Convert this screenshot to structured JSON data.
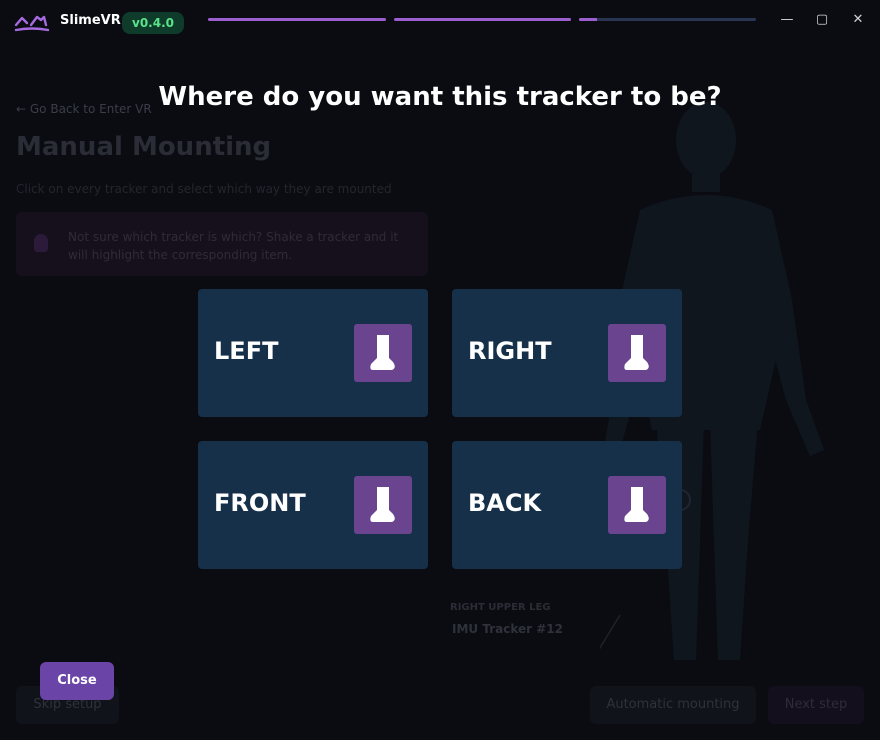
{
  "app": {
    "name": "SlimeVR",
    "version": "v0.4.0"
  },
  "progress": [
    {
      "fill": 1.0
    },
    {
      "fill": 1.0
    },
    {
      "fill": 0.1
    }
  ],
  "window_controls": {
    "minimize": "—",
    "maximize": "▢",
    "close": "✕"
  },
  "background": {
    "back_link": "Go Back to Enter VR",
    "title": "Manual Mounting",
    "description": "Click on every tracker and select which way they are mounted",
    "tip": "Not sure which tracker is which? Shake a tracker and it will highlight the corresponding item.",
    "tracker_location": "RIGHT UPPER LEG",
    "tracker_name": "IMU Tracker #12",
    "skip_label": "Skip setup",
    "automatic_label": "Automatic mounting",
    "next_label": "Next step"
  },
  "modal": {
    "title": "Where do you want this tracker to be?",
    "options": [
      {
        "label": "LEFT",
        "icon": "foot-icon"
      },
      {
        "label": "RIGHT",
        "icon": "foot-icon"
      },
      {
        "label": "FRONT",
        "icon": "foot-icon"
      },
      {
        "label": "BACK",
        "icon": "foot-icon"
      }
    ],
    "close_label": "Close"
  },
  "colors": {
    "accent": "#6b44a8",
    "card": "#173049",
    "icon_bg": "#6b4490",
    "version_text": "#5ae38a"
  }
}
